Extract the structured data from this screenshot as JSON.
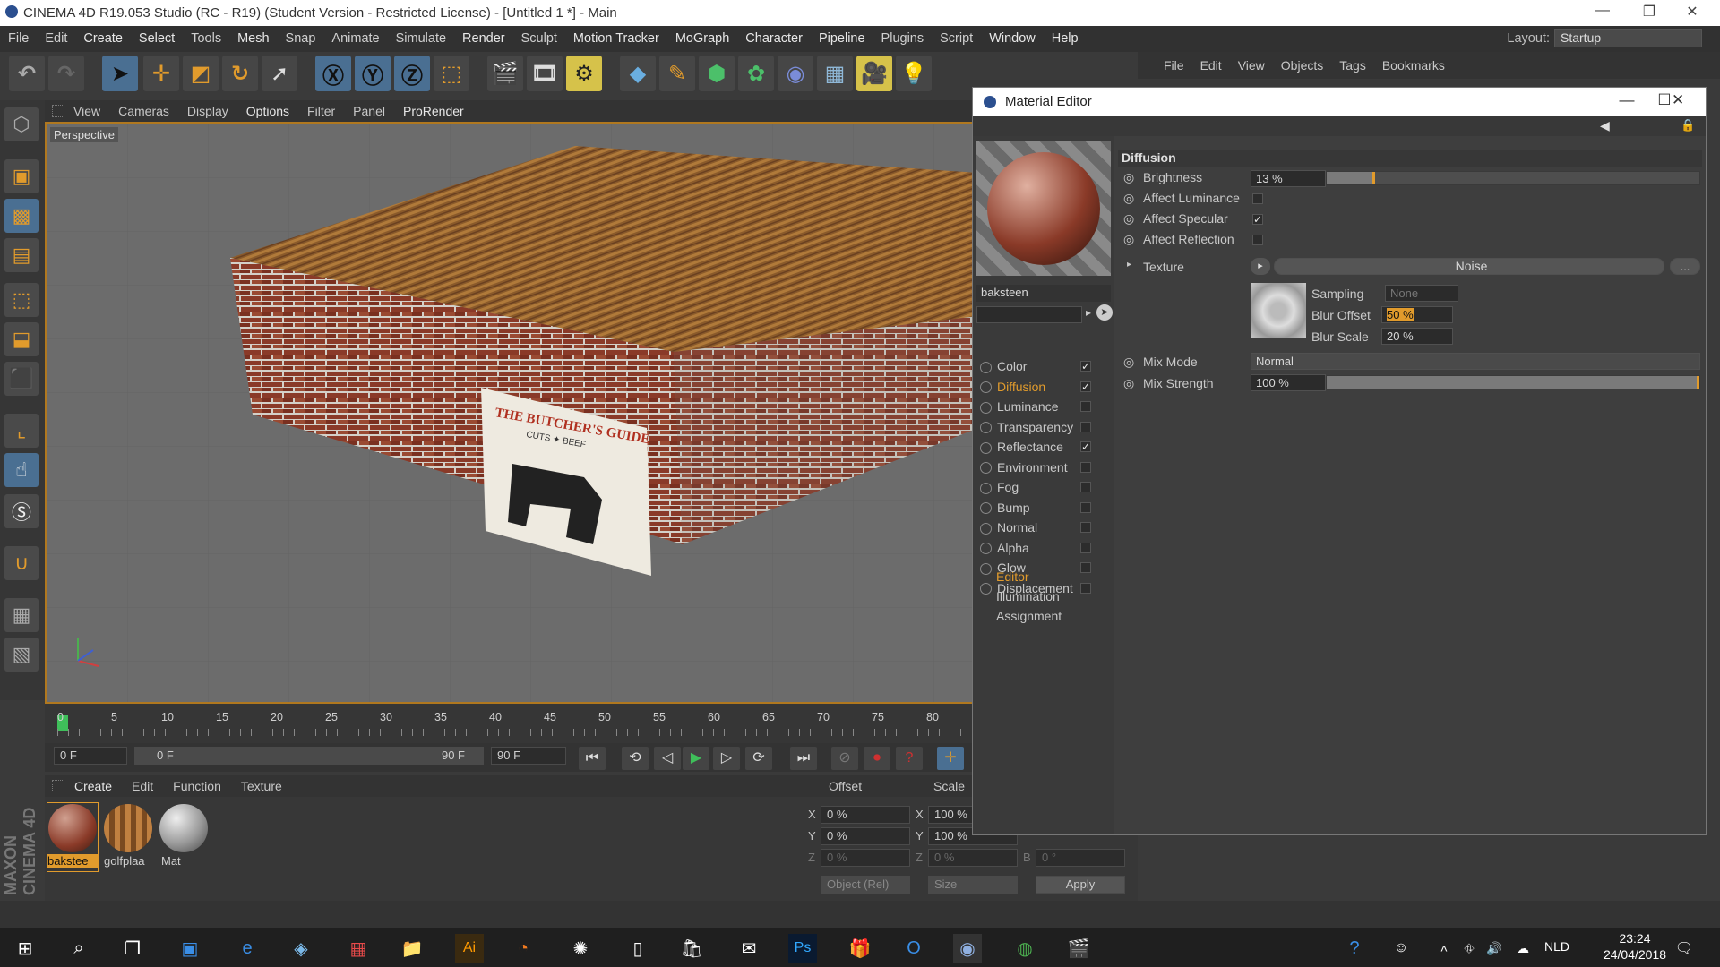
{
  "window": {
    "title": "CINEMA 4D R19.053 Studio (RC - R19) (Student Version - Restricted License) - [Untitled 1 *] - Main"
  },
  "main_menu": [
    "File",
    "Edit",
    "Create",
    "Select",
    "Tools",
    "Mesh",
    "Snap",
    "Animate",
    "Simulate",
    "Render",
    "Sculpt",
    "Motion Tracker",
    "MoGraph",
    "Character",
    "Pipeline",
    "Plugins",
    "Script",
    "Window",
    "Help"
  ],
  "layout": {
    "label": "Layout:",
    "value": "Startup"
  },
  "viewport": {
    "menu": [
      "View",
      "Cameras",
      "Display",
      "Options",
      "Filter",
      "Panel",
      "ProRender"
    ],
    "label": "Perspective",
    "poster": {
      "title": "THE BUTCHER'S GUIDE",
      "subtitle": "CUTS ✦ BEEF"
    }
  },
  "timeline": {
    "ticks": [
      "0",
      "5",
      "10",
      "15",
      "20",
      "25",
      "30",
      "35",
      "40",
      "45",
      "50",
      "55",
      "60",
      "65",
      "70",
      "75",
      "80"
    ],
    "current_frame": "0 F",
    "range_start": "0 F",
    "range_end_inner": "90 F",
    "range_end": "90 F"
  },
  "material_manager": {
    "menu": [
      "Create",
      "Edit",
      "Function",
      "Texture"
    ],
    "materials": [
      {
        "name": "bakstee",
        "selected": true
      },
      {
        "name": "golfplaa",
        "selected": false
      },
      {
        "name": "Mat",
        "selected": false
      }
    ]
  },
  "coordinates": {
    "headers": {
      "offset": "Offset",
      "scale": "Scale"
    },
    "rows": [
      {
        "axis": "X",
        "offset": "0 %",
        "saxis": "X",
        "scale": "100 %"
      },
      {
        "axis": "Y",
        "offset": "0 %",
        "saxis": "Y",
        "scale": "100 %"
      },
      {
        "axis": "Z",
        "offset": "0 %",
        "saxis": "Z",
        "scale": "0 %",
        "raxis": "B",
        "rot": "0 °"
      }
    ],
    "mode": "Object (Rel)",
    "size_mode": "Size",
    "apply": "Apply"
  },
  "object_manager": {
    "menu": [
      "File",
      "Edit",
      "View",
      "Objects",
      "Tags",
      "Bookmarks"
    ]
  },
  "material_editor": {
    "title": "Material Editor",
    "material_name": "baksteen",
    "channels": [
      {
        "label": "Color",
        "checked": true,
        "active": false
      },
      {
        "label": "Diffusion",
        "checked": true,
        "active": true
      },
      {
        "label": "Luminance",
        "checked": false,
        "active": false
      },
      {
        "label": "Transparency",
        "checked": false,
        "active": false
      },
      {
        "label": "Reflectance",
        "checked": true,
        "active": false
      },
      {
        "label": "Environment",
        "checked": false,
        "active": false
      },
      {
        "label": "Fog",
        "checked": false,
        "active": false
      },
      {
        "label": "Bump",
        "checked": false,
        "active": false
      },
      {
        "label": "Normal",
        "checked": false,
        "active": false
      },
      {
        "label": "Alpha",
        "checked": false,
        "active": false
      },
      {
        "label": "Glow",
        "checked": false,
        "active": false
      },
      {
        "label": "Displacement",
        "checked": false,
        "active": false
      }
    ],
    "extras": [
      "Editor",
      "Illumination",
      "Assignment"
    ],
    "section": "Diffusion",
    "brightness": {
      "label": "Brightness",
      "value": "13 %",
      "fraction": 0.13
    },
    "affect_luminance": {
      "label": "Affect Luminance",
      "checked": false
    },
    "affect_specular": {
      "label": "Affect Specular",
      "checked": true
    },
    "affect_reflection": {
      "label": "Affect Reflection",
      "checked": false
    },
    "texture": {
      "label": "Texture",
      "shader": "Noise",
      "more": "..."
    },
    "sampling": {
      "label": "Sampling",
      "value": "None"
    },
    "blur_offset": {
      "label": "Blur Offset",
      "value": "50 %"
    },
    "blur_scale": {
      "label": "Blur Scale",
      "value": "20 %"
    },
    "mix_mode": {
      "label": "Mix Mode",
      "value": "Normal"
    },
    "mix_strength": {
      "label": "Mix Strength",
      "value": "100 %",
      "fraction": 1.0
    }
  },
  "taskbar": {
    "language": "NLD",
    "time": "23:24",
    "date": "24/04/2018"
  },
  "colors": {
    "accent_orange": "#e19b2c",
    "selection_blue": "#4a6f92",
    "ui_dark": "#3a3a3a"
  }
}
